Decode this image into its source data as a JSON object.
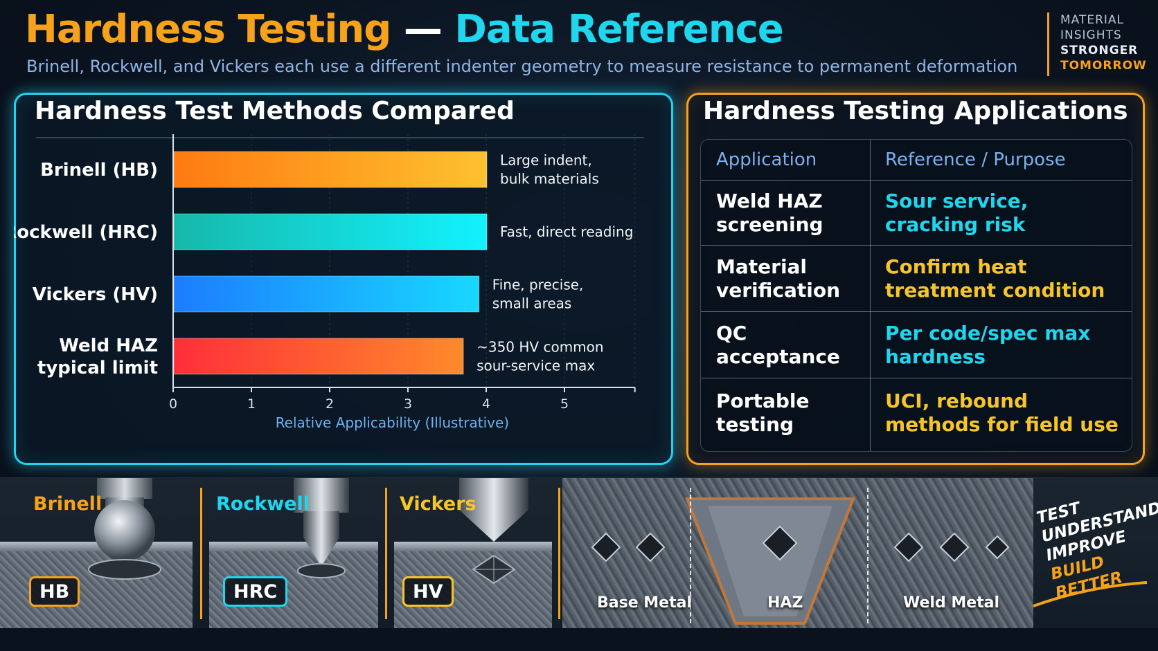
{
  "header": {
    "title_part1": "Hardness Testing",
    "title_dash": " — ",
    "title_part2": "Data Reference",
    "subtitle": "Brinell, Rockwell, and Vickers each use a different indenter geometry to measure resistance to permanent deformation"
  },
  "brand": {
    "line1": "MATERIAL",
    "line2": "INSIGHTS",
    "line3": "STRONGER",
    "line4": "TOMORROW"
  },
  "colors": {
    "orange": "#f6a21a",
    "cyan": "#1fd6ee",
    "yellow": "#f7c52a",
    "brinell_bar": [
      "#ff7a12",
      "#fcc22e"
    ],
    "rockwell_bar": [
      "#17b8aa",
      "#12f2ff"
    ],
    "vickers_bar": [
      "#1c7cff",
      "#18d8ff"
    ],
    "weld_bar": [
      "#ff2e3a",
      "#ff8a2a"
    ]
  },
  "chart_data": {
    "type": "bar",
    "orientation": "horizontal",
    "title": "Hardness Test Methods Compared",
    "xlabel": "Relative Applicability (Illustrative)",
    "ylabel": "",
    "xlim": [
      0,
      5.9
    ],
    "xticks": [
      0,
      1,
      2,
      3,
      4,
      5
    ],
    "categories": [
      "Brinell (HB)",
      "Rockwell (HRC)",
      "Vickers (HV)",
      "Weld HAZ typical limit"
    ],
    "category_lines": [
      [
        "Brinell (HB)"
      ],
      [
        "Rockwell (HRC)"
      ],
      [
        "Vickers (HV)"
      ],
      [
        "Weld HAZ",
        "typical limit"
      ]
    ],
    "values": [
      4.0,
      4.0,
      3.9,
      3.7
    ],
    "annotations": [
      [
        "Large indent,",
        "bulk materials"
      ],
      [
        "Fast, direct reading"
      ],
      [
        "Fine, precise,",
        "small areas"
      ],
      [
        "~350 HV common",
        "sour-service max"
      ]
    ],
    "grid": true,
    "legend": "none"
  },
  "applications": {
    "title": "Hardness Testing Applications",
    "headers": [
      "Application",
      "Reference / Purpose"
    ],
    "rows": [
      {
        "app": "Weld HAZ screening",
        "purpose": "Sour service, cracking risk",
        "color": "#1fd6ee"
      },
      {
        "app": "Material verification",
        "purpose": "Confirm  heat treatment condition",
        "color": "#f7c52a"
      },
      {
        "app": "QC acceptance",
        "purpose": "Per code/spec max hardness",
        "color": "#1fd6ee"
      },
      {
        "app": "Portable testing",
        "purpose": "UCI, rebound methods for field use",
        "color": "#f7c52a"
      }
    ]
  },
  "indenters": [
    {
      "label": "Brinell",
      "badge": "HB",
      "color": "#f6a21a",
      "badge_color": "#f6a21a"
    },
    {
      "label": "Rockwell",
      "badge": "HRC",
      "color": "#1fd6ee",
      "badge_color": "#1fd6ee"
    },
    {
      "label": "Vickers",
      "badge": "HV",
      "color": "#f7c52a",
      "badge_color": "#f7c52a"
    }
  ],
  "weld_zones": [
    "Base Metal",
    "HAZ",
    "Weld Metal"
  ],
  "slogan": [
    "TEST",
    "UNDERSTAND",
    "IMPROVE",
    "BUILD BETTER"
  ]
}
